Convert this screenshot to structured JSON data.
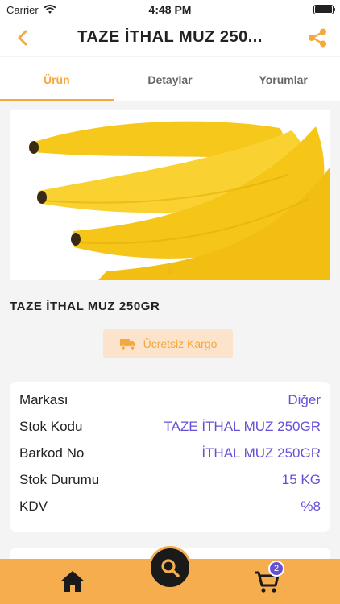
{
  "status_bar": {
    "carrier": "Carrier",
    "time": "4:48 PM"
  },
  "nav": {
    "title": "TAZE İTHAL MUZ 250..."
  },
  "tabs": [
    {
      "label": "Ürün",
      "active": true
    },
    {
      "label": "Detaylar",
      "active": false
    },
    {
      "label": "Yorumlar",
      "active": false
    }
  ],
  "product": {
    "title": "TAZE İTHAL MUZ 250GR",
    "shipping_badge": "Ücretsiz Kargo"
  },
  "info_rows": [
    {
      "label": "Markası",
      "value": "Diğer"
    },
    {
      "label": "Stok Kodu",
      "value": "TAZE İTHAL MUZ 250GR"
    },
    {
      "label": "Barkod No",
      "value": "İTHAL MUZ 250GR"
    },
    {
      "label": "Stok Durumu",
      "value": "15 KG"
    },
    {
      "label": "KDV",
      "value": "%8"
    }
  ],
  "bottom_bar": {
    "cart_count": "2"
  },
  "colors": {
    "accent": "#f5a83e",
    "value": "#6651d6",
    "bar": "#f6ad4e"
  }
}
